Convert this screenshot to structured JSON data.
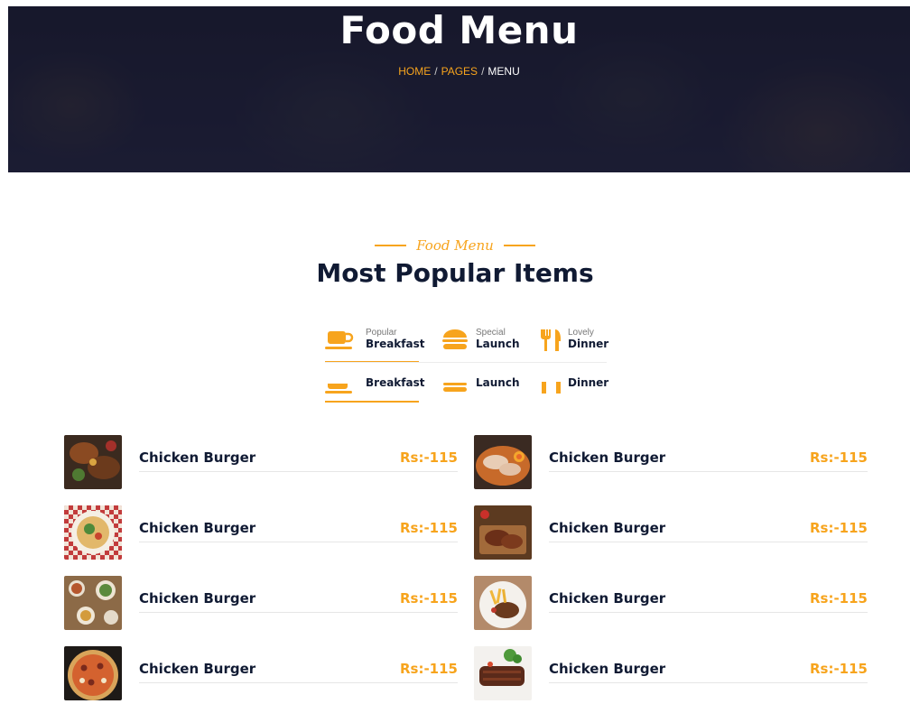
{
  "hero": {
    "title": "Food Menu",
    "breadcrumb": {
      "home": "HOME",
      "pages": "PAGES",
      "current": "MENU",
      "separator": "/"
    }
  },
  "section": {
    "subtitle": "Food Menu",
    "title": "Most Popular Items"
  },
  "tabs": {
    "row1": [
      {
        "small": "Popular",
        "big": "Breakfast",
        "icon": "cup-icon"
      },
      {
        "small": "Special",
        "big": "Launch",
        "icon": "burger-icon"
      },
      {
        "small": "Lovely",
        "big": "Dinner",
        "icon": "fork-knife-icon"
      }
    ],
    "row2": [
      {
        "big": "Breakfast",
        "icon": "cup-icon"
      },
      {
        "big": "Launch",
        "icon": "burger-icon"
      },
      {
        "big": "Dinner",
        "icon": "fork-knife-icon"
      }
    ]
  },
  "menu": {
    "left": [
      {
        "name": "Chicken Burger",
        "price": "Rs:-115",
        "image": "grilled-dish"
      },
      {
        "name": "Chicken Burger",
        "price": "Rs:-115",
        "image": "salad-plate"
      },
      {
        "name": "Chicken Burger",
        "price": "Rs:-115",
        "image": "table-spread"
      },
      {
        "name": "Chicken Burger",
        "price": "Rs:-115",
        "image": "pizza"
      }
    ],
    "right": [
      {
        "name": "Chicken Burger",
        "price": "Rs:-115",
        "image": "ramen-bowl"
      },
      {
        "name": "Chicken Burger",
        "price": "Rs:-115",
        "image": "steak-board"
      },
      {
        "name": "Chicken Burger",
        "price": "Rs:-115",
        "image": "steak-fries"
      },
      {
        "name": "Chicken Burger",
        "price": "Rs:-115",
        "image": "grilled-meat"
      }
    ]
  },
  "colors": {
    "accent": "#f7a41d",
    "heading": "#101a33",
    "hero_overlay": "#1e2038"
  }
}
